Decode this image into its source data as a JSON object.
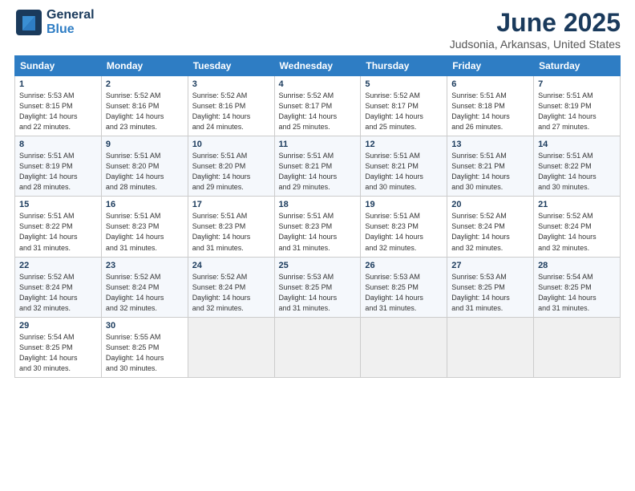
{
  "app": {
    "logo_line1": "General",
    "logo_line2": "Blue",
    "title": "June 2025",
    "subtitle": "Judsonia, Arkansas, United States"
  },
  "calendar": {
    "headers": [
      "Sunday",
      "Monday",
      "Tuesday",
      "Wednesday",
      "Thursday",
      "Friday",
      "Saturday"
    ],
    "weeks": [
      [
        {
          "day": "",
          "info": ""
        },
        {
          "day": "2",
          "info": "Sunrise: 5:52 AM\nSunset: 8:16 PM\nDaylight: 14 hours\nand 23 minutes."
        },
        {
          "day": "3",
          "info": "Sunrise: 5:52 AM\nSunset: 8:16 PM\nDaylight: 14 hours\nand 24 minutes."
        },
        {
          "day": "4",
          "info": "Sunrise: 5:52 AM\nSunset: 8:17 PM\nDaylight: 14 hours\nand 25 minutes."
        },
        {
          "day": "5",
          "info": "Sunrise: 5:52 AM\nSunset: 8:17 PM\nDaylight: 14 hours\nand 25 minutes."
        },
        {
          "day": "6",
          "info": "Sunrise: 5:51 AM\nSunset: 8:18 PM\nDaylight: 14 hours\nand 26 minutes."
        },
        {
          "day": "7",
          "info": "Sunrise: 5:51 AM\nSunset: 8:19 PM\nDaylight: 14 hours\nand 27 minutes."
        }
      ],
      [
        {
          "day": "8",
          "info": "Sunrise: 5:51 AM\nSunset: 8:19 PM\nDaylight: 14 hours\nand 28 minutes."
        },
        {
          "day": "9",
          "info": "Sunrise: 5:51 AM\nSunset: 8:20 PM\nDaylight: 14 hours\nand 28 minutes."
        },
        {
          "day": "10",
          "info": "Sunrise: 5:51 AM\nSunset: 8:20 PM\nDaylight: 14 hours\nand 29 minutes."
        },
        {
          "day": "11",
          "info": "Sunrise: 5:51 AM\nSunset: 8:21 PM\nDaylight: 14 hours\nand 29 minutes."
        },
        {
          "day": "12",
          "info": "Sunrise: 5:51 AM\nSunset: 8:21 PM\nDaylight: 14 hours\nand 30 minutes."
        },
        {
          "day": "13",
          "info": "Sunrise: 5:51 AM\nSunset: 8:21 PM\nDaylight: 14 hours\nand 30 minutes."
        },
        {
          "day": "14",
          "info": "Sunrise: 5:51 AM\nSunset: 8:22 PM\nDaylight: 14 hours\nand 30 minutes."
        }
      ],
      [
        {
          "day": "15",
          "info": "Sunrise: 5:51 AM\nSunset: 8:22 PM\nDaylight: 14 hours\nand 31 minutes."
        },
        {
          "day": "16",
          "info": "Sunrise: 5:51 AM\nSunset: 8:23 PM\nDaylight: 14 hours\nand 31 minutes."
        },
        {
          "day": "17",
          "info": "Sunrise: 5:51 AM\nSunset: 8:23 PM\nDaylight: 14 hours\nand 31 minutes."
        },
        {
          "day": "18",
          "info": "Sunrise: 5:51 AM\nSunset: 8:23 PM\nDaylight: 14 hours\nand 31 minutes."
        },
        {
          "day": "19",
          "info": "Sunrise: 5:51 AM\nSunset: 8:23 PM\nDaylight: 14 hours\nand 32 minutes."
        },
        {
          "day": "20",
          "info": "Sunrise: 5:52 AM\nSunset: 8:24 PM\nDaylight: 14 hours\nand 32 minutes."
        },
        {
          "day": "21",
          "info": "Sunrise: 5:52 AM\nSunset: 8:24 PM\nDaylight: 14 hours\nand 32 minutes."
        }
      ],
      [
        {
          "day": "22",
          "info": "Sunrise: 5:52 AM\nSunset: 8:24 PM\nDaylight: 14 hours\nand 32 minutes."
        },
        {
          "day": "23",
          "info": "Sunrise: 5:52 AM\nSunset: 8:24 PM\nDaylight: 14 hours\nand 32 minutes."
        },
        {
          "day": "24",
          "info": "Sunrise: 5:52 AM\nSunset: 8:24 PM\nDaylight: 14 hours\nand 32 minutes."
        },
        {
          "day": "25",
          "info": "Sunrise: 5:53 AM\nSunset: 8:25 PM\nDaylight: 14 hours\nand 31 minutes."
        },
        {
          "day": "26",
          "info": "Sunrise: 5:53 AM\nSunset: 8:25 PM\nDaylight: 14 hours\nand 31 minutes."
        },
        {
          "day": "27",
          "info": "Sunrise: 5:53 AM\nSunset: 8:25 PM\nDaylight: 14 hours\nand 31 minutes."
        },
        {
          "day": "28",
          "info": "Sunrise: 5:54 AM\nSunset: 8:25 PM\nDaylight: 14 hours\nand 31 minutes."
        }
      ],
      [
        {
          "day": "29",
          "info": "Sunrise: 5:54 AM\nSunset: 8:25 PM\nDaylight: 14 hours\nand 30 minutes."
        },
        {
          "day": "30",
          "info": "Sunrise: 5:55 AM\nSunset: 8:25 PM\nDaylight: 14 hours\nand 30 minutes."
        },
        {
          "day": "",
          "info": ""
        },
        {
          "day": "",
          "info": ""
        },
        {
          "day": "",
          "info": ""
        },
        {
          "day": "",
          "info": ""
        },
        {
          "day": "",
          "info": ""
        }
      ]
    ],
    "week0_day1": {
      "day": "1",
      "info": "Sunrise: 5:53 AM\nSunset: 8:15 PM\nDaylight: 14 hours\nand 22 minutes."
    }
  }
}
